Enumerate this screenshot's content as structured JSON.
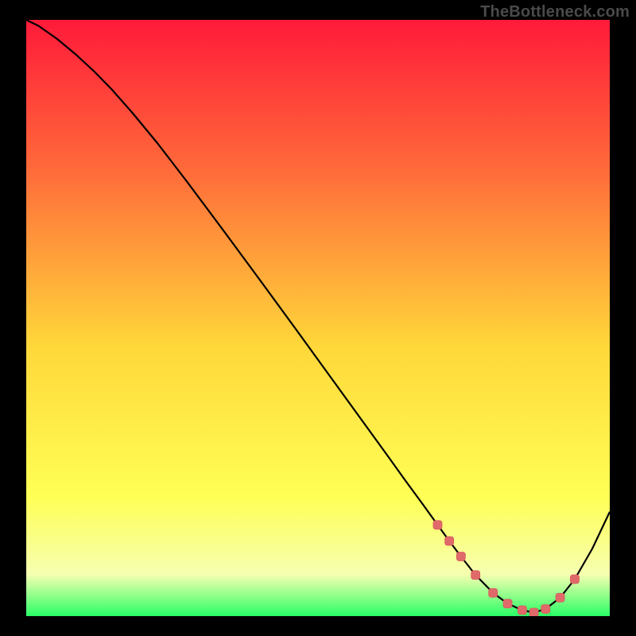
{
  "watermark": "TheBottleneck.com",
  "colors": {
    "background": "#000000",
    "gradient_top": "#ff1a3a",
    "gradient_upper": "#ff6a3a",
    "gradient_mid": "#ffd83a",
    "gradient_lower": "#ffff55",
    "gradient_lowest": "#f6ffb0",
    "gradient_bottom": "#2aff66",
    "curve": "#000000",
    "marker_fill": "#e06a6a",
    "marker_stroke": "#d65a5a"
  },
  "plot": {
    "x_domain": [
      0,
      100
    ],
    "y_domain": [
      0,
      100
    ]
  },
  "chart_data": {
    "type": "line",
    "title": "",
    "xlabel": "",
    "ylabel": "",
    "xlim": [
      0,
      100
    ],
    "ylim": [
      0,
      100
    ],
    "series": [
      {
        "name": "curve",
        "x": [
          0,
          2.1,
          5.3,
          8.5,
          11.7,
          14.6,
          18.2,
          22.5,
          27.6,
          34.0,
          40.4,
          46.0,
          50.0,
          54.0,
          58.0,
          62.0,
          65.0,
          68.0,
          70.5,
          72.5,
          74.5,
          77.0,
          80.0,
          82.5,
          85.0,
          87.0,
          89.0,
          91.5,
          94.0,
          97.0,
          100.0
        ],
        "y": [
          100.0,
          99.0,
          96.8,
          94.2,
          91.3,
          88.4,
          84.4,
          79.3,
          72.8,
          64.4,
          55.9,
          48.4,
          43.0,
          37.6,
          32.2,
          26.8,
          22.7,
          18.7,
          15.3,
          12.6,
          10.0,
          6.9,
          3.9,
          2.1,
          1.0,
          0.6,
          1.2,
          3.1,
          6.2,
          11.3,
          17.5
        ]
      }
    ],
    "highlighted_range": {
      "x_start": 70.5,
      "x_end": 94.0,
      "description": "markers along trough"
    }
  }
}
